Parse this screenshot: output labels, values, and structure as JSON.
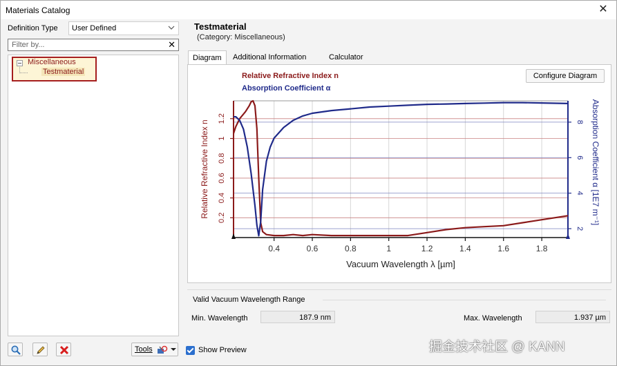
{
  "window": {
    "title": "Materials Catalog",
    "close_glyph": "✕"
  },
  "left": {
    "definition_type_label": "Definition Type",
    "definition_type_value": "User Defined",
    "filter_placeholder": "Filter by...",
    "filter_clear_glyph": "✕",
    "tree": {
      "parent": "Miscellaneous",
      "child": "Testmaterial"
    },
    "toolbar": {
      "tools_label": "Tools"
    }
  },
  "material": {
    "name": "Testmaterial",
    "category": "(Category: Miscellaneous)"
  },
  "tabs": [
    {
      "label": "Diagram",
      "active": true
    },
    {
      "label": "Additional Information",
      "active": false
    },
    {
      "label": "Calculator",
      "active": false
    }
  ],
  "diagram": {
    "configure_button": "Configure Diagram",
    "legend": {
      "n": "Relative Refractive Index n",
      "alpha": "Absorption Coefficient α"
    }
  },
  "chart_data": {
    "type": "line",
    "xlabel": "Vacuum Wavelength λ [µm]",
    "ylabel_left": "Relative Refractive Index n",
    "ylabel_right": "Absorption Coefficient α [1E7 m⁻¹]",
    "xlim": [
      0.188,
      1.937
    ],
    "ylim_left": [
      0,
      1.38
    ],
    "ylim_right": [
      1.5,
      9.2
    ],
    "xticks": [
      0.4,
      0.6,
      0.8,
      1,
      1.2,
      1.4,
      1.6,
      1.8
    ],
    "xtick_labels": [
      "0.4",
      "0.6",
      "0.8",
      "1",
      "1.2",
      "1.4",
      "1.6",
      "1.8"
    ],
    "yticks_left": [
      0.2,
      0.4,
      0.6,
      0.8,
      1,
      1.2
    ],
    "ytick_labels_left": [
      "0.2",
      "0.4",
      "0.6",
      "0.8",
      "1",
      "1.2"
    ],
    "yticks_right": [
      2,
      4,
      6,
      8
    ],
    "ytick_labels_right": [
      "2",
      "4",
      "6",
      "8"
    ],
    "colors": {
      "n": "#8b1a1a",
      "alpha": "#1f2a8a"
    },
    "series": [
      {
        "name": "Relative Refractive Index n",
        "axis": "left",
        "x": [
          0.188,
          0.2,
          0.22,
          0.25,
          0.27,
          0.28,
          0.29,
          0.3,
          0.31,
          0.32,
          0.33,
          0.34,
          0.36,
          0.4,
          0.45,
          0.5,
          0.55,
          0.6,
          0.7,
          0.8,
          0.9,
          1.0,
          1.1,
          1.2,
          1.3,
          1.4,
          1.5,
          1.6,
          1.7,
          1.8,
          1.9,
          1.937
        ],
        "values": [
          1.05,
          1.12,
          1.2,
          1.27,
          1.33,
          1.37,
          1.38,
          1.33,
          1.1,
          0.6,
          0.15,
          0.06,
          0.03,
          0.02,
          0.02,
          0.03,
          0.02,
          0.03,
          0.02,
          0.02,
          0.02,
          0.02,
          0.02,
          0.05,
          0.08,
          0.1,
          0.11,
          0.12,
          0.15,
          0.18,
          0.21,
          0.22
        ]
      },
      {
        "name": "Absorption Coefficient α",
        "axis": "right",
        "x": [
          0.188,
          0.2,
          0.22,
          0.24,
          0.26,
          0.28,
          0.3,
          0.31,
          0.32,
          0.33,
          0.34,
          0.36,
          0.38,
          0.4,
          0.45,
          0.5,
          0.55,
          0.6,
          0.7,
          0.8,
          0.9,
          1.0,
          1.1,
          1.2,
          1.3,
          1.4,
          1.5,
          1.6,
          1.7,
          1.8,
          1.937
        ],
        "values": [
          8.3,
          8.3,
          8.1,
          7.6,
          6.6,
          5.1,
          3.3,
          2.2,
          1.6,
          2.4,
          4.2,
          5.8,
          6.6,
          7.1,
          7.7,
          8.1,
          8.35,
          8.5,
          8.65,
          8.75,
          8.85,
          8.9,
          8.95,
          9.0,
          9.02,
          9.05,
          9.07,
          9.1,
          9.1,
          9.08,
          9.05
        ]
      }
    ]
  },
  "range": {
    "title": "Valid Vacuum Wavelength Range",
    "min_label": "Min. Wavelength",
    "min_value": "187.9 nm",
    "max_label": "Max. Wavelength",
    "max_value": "1.937 µm"
  },
  "preview": {
    "label": "Show Preview",
    "checked": true
  },
  "watermark": "掘金技术社区 @ KANN"
}
